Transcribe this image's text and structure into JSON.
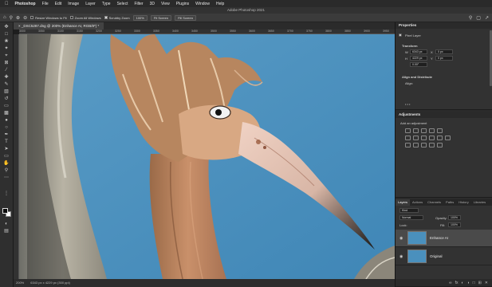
{
  "menubar": {
    "apple_icon": "apple-icon",
    "items": [
      "Photoshop",
      "File",
      "Edit",
      "Image",
      "Layer",
      "Type",
      "Select",
      "Filter",
      "3D",
      "View",
      "Plugins",
      "Window",
      "Help"
    ]
  },
  "titlebar": {
    "title": "Adobe Photoshop 2021"
  },
  "options_bar": {
    "resize_windows_label": "Resize Windows to Fit",
    "zoom_all_label": "Zoom All Windows",
    "scrubby_zoom_label": "Scrubby Zoom",
    "zoom_value": "100%",
    "fit_screen_label": "Fit Screen",
    "fill_screen_label": "Fill Screen"
  },
  "document_tab": {
    "title": "_DSC5287.dng @ 200% (Enhance AI, RGB/8*) *"
  },
  "ruler": {
    "ticks": [
      "3000",
      "3050",
      "3100",
      "3150",
      "3200",
      "3250",
      "3300",
      "3350",
      "3400",
      "3450",
      "3500",
      "3550",
      "3600",
      "3650",
      "3700",
      "3750",
      "3800",
      "3850",
      "3900",
      "3950"
    ]
  },
  "status_bar": {
    "zoom": "200%",
    "doc_info": "6343 px x 4229 px (300 ppi)"
  },
  "properties_panel": {
    "title": "Properties",
    "layer_type": "Pixel Layer",
    "transform_label": "Transform",
    "w_label": "W",
    "w_value": "6343 px",
    "h_label": "H",
    "h_value": "4229 px",
    "x_label": "X",
    "x_value": "0 px",
    "y_label": "Y",
    "y_value": "0 px",
    "angle_value": "0.00°",
    "align_distribute_label": "Align and Distribute",
    "align_label": "Align:",
    "more_label": "• • •"
  },
  "adjustments_panel": {
    "title": "Adjustments",
    "subtitle": "Add an adjustment"
  },
  "layers_panel": {
    "tabs": [
      "Layers",
      "Actions",
      "Channels",
      "Paths",
      "History",
      "Libraries"
    ],
    "kind_label": "Kind",
    "blend_mode": "Normal",
    "opacity_label": "Opacity:",
    "opacity_value": "100%",
    "lock_label": "Lock:",
    "fill_label": "Fill:",
    "fill_value": "100%",
    "layers": [
      {
        "name": "Enhance AI"
      },
      {
        "name": "Original"
      }
    ]
  },
  "colors": {
    "sky": "#4a90bd",
    "panel_bg": "#2b2b2b",
    "ui_bg": "#1e1e1e"
  }
}
